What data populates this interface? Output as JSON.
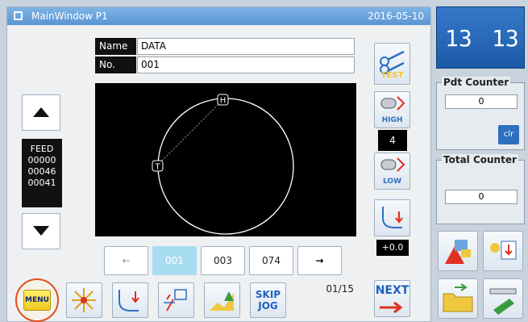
{
  "window": {
    "title": "MainWindow P1",
    "date": "2016-05-10"
  },
  "info": {
    "name_label": "Name",
    "name_value": "DATA",
    "no_label": "No.",
    "no_value": "001"
  },
  "feed": {
    "label": "FEED",
    "values": [
      "00000",
      "00046",
      "00041"
    ]
  },
  "canvas": {
    "marker_h": "H",
    "marker_t": "T"
  },
  "pager": {
    "prev": "←",
    "p1": "001",
    "p2": "003",
    "p3": "074",
    "next": "→",
    "page_info": "01/15"
  },
  "tools": {
    "test_label": "TEST",
    "high_label": "HIGH",
    "speed_value": "4",
    "low_label": "LOW",
    "offset_value": "+0.0",
    "next_label": "NEXT",
    "skip_label": "SKIP",
    "jog_label": "JOG",
    "menu_label": "MENU"
  },
  "right": {
    "clock_left": "13",
    "clock_right": "13",
    "pdt_label": "Pdt Counter",
    "pdt_value": "0",
    "clr_label": "clr",
    "total_label": "Total Counter",
    "total_value": "0"
  },
  "colors": {
    "title_bar": "#6aa6e0",
    "accent_blue": "#2e6fc0",
    "menu_ring": "#e05020"
  }
}
